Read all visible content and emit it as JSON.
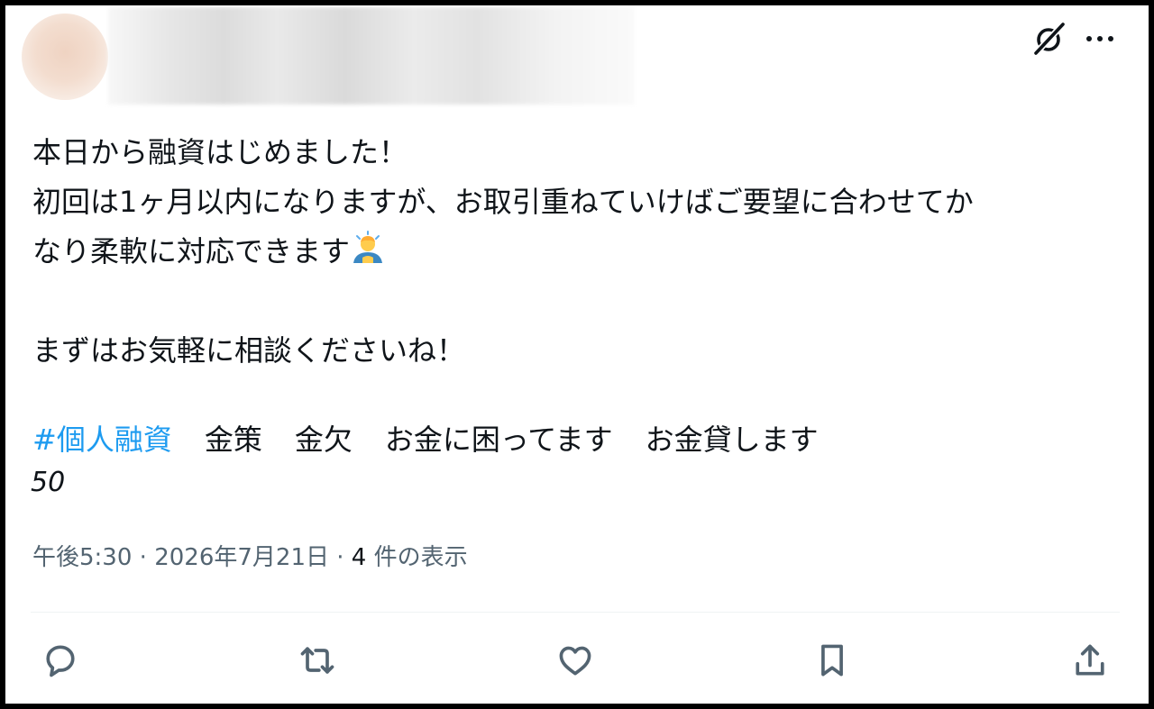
{
  "author": {
    "avatar_icon": "blurred-avatar",
    "name_display": "blurred"
  },
  "header_icons": {
    "grok": "grok-icon",
    "more": "more-icon",
    "more_glyph": "···"
  },
  "tweet": {
    "line1": "本日から融資はじめました！",
    "line2": "初回は1ヶ月以内になりますが、お取引重ねていけばご要望に合わせてか",
    "line3": "なり柔軟に対応できます",
    "line3_emoji": "person-bowing-emoji",
    "line4": "まずはお気軽に相談くださいね！",
    "hashtag": "#個人融資",
    "tags": [
      "金策",
      "金欠",
      "お金に困ってます",
      "お金貸します"
    ],
    "number": "50"
  },
  "meta": {
    "time": "午後5:30",
    "date": "2026年7月21日",
    "separator": "·",
    "views_count": "4",
    "views_label": " 件の表示"
  },
  "actions": [
    "reply-icon",
    "retweet-icon",
    "like-icon",
    "bookmark-icon",
    "share-icon"
  ],
  "colors": {
    "link": "#1d9bf0",
    "text": "#0f1419",
    "secondary": "#536471",
    "icon": "#536471"
  }
}
